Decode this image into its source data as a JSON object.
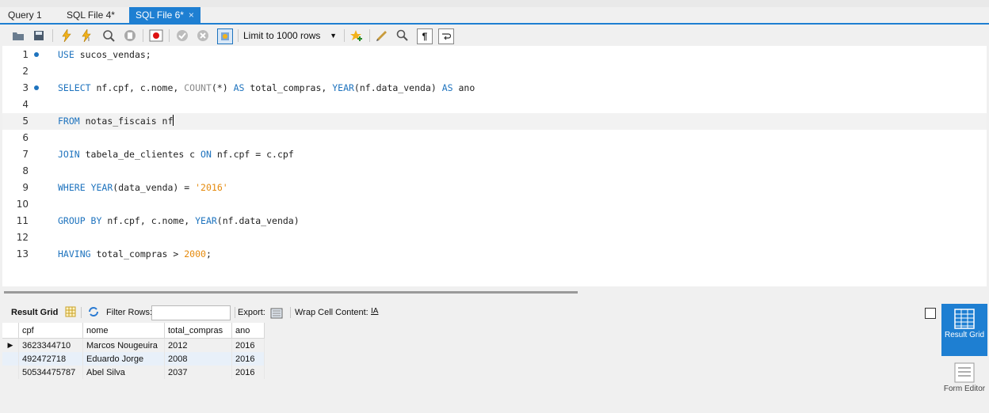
{
  "tabs": [
    {
      "label": "Query 1",
      "active": false
    },
    {
      "label": "SQL File 4*",
      "active": false
    },
    {
      "label": "SQL File 6*",
      "active": true,
      "close": "×"
    }
  ],
  "toolbar": {
    "limit_select": "Limit to 1000 rows",
    "icons": [
      "open-folder-icon",
      "save-icon",
      "execute-icon",
      "execute-selection-icon",
      "explain-icon",
      "stop-icon",
      "toggle-results-icon",
      "commit-icon",
      "rollback-icon",
      "autocommit-icon",
      "beautify-icon",
      "find-icon",
      "invisible-chars-icon",
      "wrap-icon"
    ]
  },
  "editor": {
    "lines": [
      {
        "num": "1",
        "marker": true
      },
      {
        "num": "2",
        "marker": false
      },
      {
        "num": "3",
        "marker": true
      },
      {
        "num": "4",
        "marker": false
      },
      {
        "num": "5",
        "marker": false
      },
      {
        "num": "6",
        "marker": false
      },
      {
        "num": "7",
        "marker": false
      },
      {
        "num": "8",
        "marker": false
      },
      {
        "num": "9",
        "marker": false
      },
      {
        "num": "10",
        "marker": false
      },
      {
        "num": "11",
        "marker": false
      },
      {
        "num": "12",
        "marker": false
      },
      {
        "num": "13",
        "marker": false
      }
    ],
    "code": {
      "l1_kw": "USE",
      "l1_rest": " sucos_vendas;",
      "l3_kw1": "SELECT",
      "l3_a": " nf.cpf, c.nome, ",
      "l3_fn": "COUNT",
      "l3_b": "(*) ",
      "l3_kw2": "AS",
      "l3_c": " total_compras, ",
      "l3_fn2": "YEAR",
      "l3_d": "(nf.data_venda) ",
      "l3_kw3": "AS",
      "l3_e": " ano",
      "l5_kw": "FROM",
      "l5_rest": " notas_fiscais nf",
      "l7_kw": "JOIN",
      "l7_a": " tabela_de_clientes c ",
      "l7_kw2": "ON",
      "l7_b": " nf.cpf = c.cpf",
      "l9_kw": "WHERE",
      "l9_sp": " ",
      "l9_fn": "YEAR",
      "l9_a": "(data_venda) = ",
      "l9_str": "'2016'",
      "l11_kw": "GROUP BY",
      "l11_a": " nf.cpf, c.nome, ",
      "l11_fn": "YEAR",
      "l11_b": "(nf.data_venda)",
      "l13_kw": "HAVING",
      "l13_a": " total_compras > ",
      "l13_num": "2000",
      "l13_b": ";"
    }
  },
  "results_toolbar": {
    "result_grid": "Result Grid",
    "filter_rows": "Filter Rows:",
    "export": "Export:",
    "wrap_cell": "Wrap Cell Content:"
  },
  "grid": {
    "columns": [
      "cpf",
      "nome",
      "total_compras",
      "ano"
    ],
    "rows": [
      {
        "cpf": "3623344710",
        "nome": "Marcos Nougeuira",
        "total_compras": "2012",
        "ano": "2016"
      },
      {
        "cpf": "492472718",
        "nome": "Eduardo Jorge",
        "total_compras": "2008",
        "ano": "2016"
      },
      {
        "cpf": "50534475787",
        "nome": "Abel Silva",
        "total_compras": "2037",
        "ano": "2016"
      }
    ]
  },
  "side_panel": {
    "result_grid_btn": "Result Grid",
    "form_btn": "Form Editor"
  },
  "colors": {
    "accent": "#1e7fd2",
    "keyword": "#1e73be",
    "literal": "#e58a0c"
  }
}
